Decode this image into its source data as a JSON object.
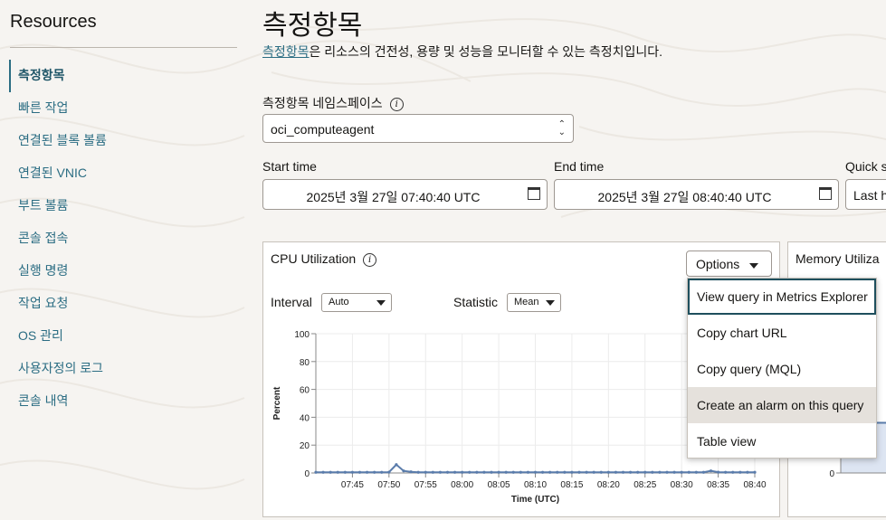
{
  "sidebar": {
    "title": "Resources",
    "items": [
      {
        "label": "측정항목",
        "active": true
      },
      {
        "label": "빠른 작업"
      },
      {
        "label": "연결된 블록 볼륨"
      },
      {
        "label": "연결된 VNIC"
      },
      {
        "label": "부트 볼륨"
      },
      {
        "label": "콘솔 접속"
      },
      {
        "label": "실행 명령"
      },
      {
        "label": "작업 요청"
      },
      {
        "label": "OS 관리"
      },
      {
        "label": "사용자정의 로그"
      },
      {
        "label": "콘솔 내역"
      }
    ]
  },
  "header": {
    "title": "측정항목",
    "subtitle_link": "측정항목",
    "subtitle_rest": "은 리소스의 건전성, 용량 및 성능을 모니터할 수 있는 측정치입니다."
  },
  "namespace": {
    "label": "측정항목 네임스페이스",
    "value": "oci_computeagent"
  },
  "time": {
    "start_label": "Start time",
    "start_value": "2025년 3월 27일 07:40:40 UTC",
    "end_label": "End time",
    "end_value": "2025년 3월 27일 08:40:40 UTC",
    "quick_label": "Quick s",
    "quick_value": "Last h"
  },
  "cpu_card": {
    "title": "CPU Utilization",
    "options_label": "Options",
    "interval_label": "Interval",
    "interval_value": "Auto",
    "statistic_label": "Statistic",
    "statistic_value": "Mean"
  },
  "memory_card": {
    "title": "Memory Utiliza"
  },
  "options_menu": {
    "items": [
      "View query in Metrics Explorer",
      "Copy chart URL",
      "Copy query (MQL)",
      "Create an alarm on this query",
      "Table view"
    ],
    "focused_index": 0,
    "hover_index": 3
  },
  "colors": {
    "series": "#5a7cab",
    "link": "#2b6d83"
  },
  "chart_data": [
    {
      "type": "line",
      "xlabel": "Time (UTC)",
      "ylabel": "Percent",
      "ylim": [
        0,
        100
      ],
      "yticks": [
        0,
        20,
        40,
        60,
        80,
        100
      ],
      "xticks": [
        "07:45",
        "07:50",
        "07:55",
        "08:00",
        "08:05",
        "08:10",
        "08:15",
        "08:20",
        "08:25",
        "08:30",
        "08:35",
        "08:40"
      ],
      "grid": true,
      "x_minutes_range": [
        0,
        60
      ],
      "series": [
        {
          "x": [
            0,
            1,
            2,
            3,
            4,
            5,
            6,
            7,
            8,
            9,
            10,
            11,
            12,
            13,
            14,
            15,
            16,
            17,
            18,
            19,
            20,
            21,
            22,
            23,
            24,
            25,
            26,
            27,
            28,
            29,
            30,
            31,
            32,
            33,
            34,
            35,
            36,
            37,
            38,
            39,
            40,
            41,
            42,
            43,
            44,
            45,
            46,
            47,
            48,
            49,
            50,
            51,
            52,
            53,
            54,
            55,
            56,
            57,
            58,
            59,
            60
          ],
          "values": [
            0.5,
            0.5,
            0.5,
            0.5,
            0.5,
            0.5,
            0.5,
            0.5,
            0.5,
            0.5,
            0.6,
            6,
            1.5,
            0.8,
            0.5,
            0.5,
            0.5,
            0.5,
            0.5,
            0.5,
            0.5,
            0.5,
            0.5,
            0.5,
            0.5,
            0.5,
            0.5,
            0.5,
            0.5,
            0.5,
            0.5,
            0.5,
            0.5,
            0.5,
            0.5,
            0.5,
            0.5,
            0.5,
            0.5,
            0.5,
            0.5,
            0.5,
            0.5,
            0.5,
            0.5,
            0.5,
            0.5,
            0.5,
            0.5,
            0.5,
            0.5,
            0.5,
            0.5,
            0.5,
            1.5,
            0.6,
            0.5,
            0.5,
            0.5,
            0.5,
            0.5
          ]
        }
      ]
    },
    {
      "type": "area",
      "ylim": [
        0,
        100
      ],
      "yticks": [
        0
      ],
      "series": [
        {
          "values": [
            36
          ]
        }
      ]
    }
  ]
}
